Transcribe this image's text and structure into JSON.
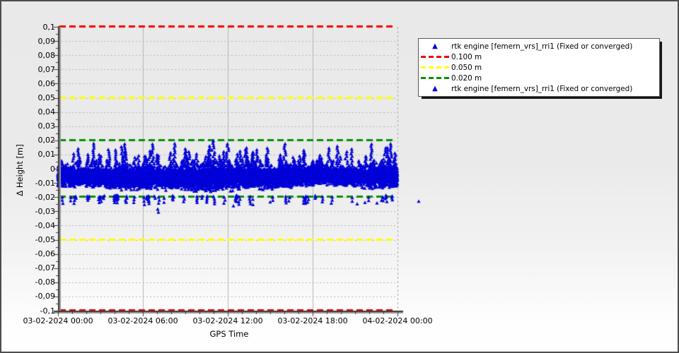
{
  "chart_data": {
    "type": "scatter",
    "title": "",
    "xlabel": "GPS Time",
    "ylabel": "Δ Height [m]",
    "x_ticks": [
      "03-02-2024 00:00",
      "03-02-2024 06:00",
      "03-02-2024 12:00",
      "03-02-2024 18:00",
      "04-02-2024 00:00"
    ],
    "x_tick_hours": [
      0,
      6,
      12,
      18,
      24
    ],
    "x_range_hours": 24,
    "y_tick_labels": [
      "0,1",
      "0,09",
      "0,08",
      "0,07",
      "0,06",
      "0,05",
      "0,04",
      "0,03",
      "0,02",
      "0,01",
      "0",
      "-0,01",
      "-0,02",
      "-0,03",
      "-0,04",
      "-0,05",
      "-0,06",
      "-0,07",
      "-0,08",
      "-0,09",
      "-0,1"
    ],
    "y_tick_values": [
      0.1,
      0.09,
      0.08,
      0.07,
      0.06,
      0.05,
      0.04,
      0.03,
      0.02,
      0.01,
      0,
      -0.01,
      -0.02,
      -0.03,
      -0.04,
      -0.05,
      -0.06,
      -0.07,
      -0.08,
      -0.09,
      -0.1
    ],
    "ylim": [
      -0.1,
      0.1
    ],
    "grid": true,
    "thresholds": [
      {
        "value": 0.1,
        "color": "#f20000",
        "label": "0.100 m"
      },
      {
        "value": -0.1,
        "color": "#f20000",
        "label": "0.100 m"
      },
      {
        "value": 0.05,
        "color": "#ffff00",
        "label": "0.050 m"
      },
      {
        "value": -0.05,
        "color": "#ffff00",
        "label": "0.050 m"
      },
      {
        "value": 0.02,
        "color": "#009000",
        "label": "0.020 m"
      },
      {
        "value": -0.02,
        "color": "#009000",
        "label": "0.020 m"
      }
    ],
    "series": [
      {
        "name": "rtk engine [femern_vrs]_rri1 (Fixed or converged)",
        "marker": "triangle",
        "color": "#0000d8",
        "summary": {
          "approx_mean": -0.005,
          "band_top": 0.005,
          "band_bottom": -0.018,
          "max": 0.02,
          "min": -0.031
        },
        "model": {
          "seed": 1337,
          "band_columns": 1700,
          "points_per_column": 5,
          "band_center": -0.0056,
          "band_center_wobble": 0.0013,
          "band_halfwidth": 0.0102,
          "band_halfwidth_wobble": 0.0024,
          "up_spike_count": 100,
          "up_spike_base": 0.0055,
          "up_spike_max_extra": 0.0125,
          "down_spike_count": 55,
          "down_spike_base": -0.0208,
          "down_spike_max_extra": 0.0048,
          "forced_up_spikes": [
            [
              219,
              0.0195,
              1.3
            ],
            [
              90,
              0.0155,
              1.0
            ],
            [
              180,
              0.014,
              1.0
            ],
            [
              213,
              0.013,
              0.8
            ],
            [
              234,
              0.012,
              0.8
            ],
            [
              240,
              0.0175,
              1.1
            ],
            [
              296,
              0.0145,
              1.0
            ],
            [
              348,
              0.013,
              1.0
            ],
            [
              383,
              0.0145,
              1.0
            ],
            [
              408,
              0.012,
              0.9
            ],
            [
              463,
              0.0147,
              1.1
            ],
            [
              130,
              0.0125,
              0.9
            ],
            [
              265,
              0.0135,
              0.9
            ]
          ],
          "forced_down_points": [
            [
              141,
              -0.0285
            ],
            [
              142,
              -0.0307
            ],
            [
              248,
              -0.0262
            ],
            [
              423,
              -0.0248
            ],
            [
              434,
              -0.0238
            ],
            [
              451,
              -0.0242
            ],
            [
              465,
              -0.0232
            ],
            [
              300,
              -0.0235
            ],
            [
              510,
              -0.023
            ]
          ]
        }
      }
    ],
    "legend_position": "right-top"
  },
  "legend": {
    "items": [
      {
        "type": "triangle",
        "color": "#0000d8",
        "label": "rtk engine [femern_vrs]_rri1 (Fixed or converged)"
      },
      {
        "type": "dash",
        "color": "#f20000",
        "label": "0.100 m"
      },
      {
        "type": "dash",
        "color": "#ffff00",
        "label": "0.050 m"
      },
      {
        "type": "dash",
        "color": "#009000",
        "label": "0.020 m"
      },
      {
        "type": "triangle",
        "color": "#0000d8",
        "label": "rtk engine [femern_vrs]_rri1 (Fixed or converged)"
      }
    ]
  }
}
